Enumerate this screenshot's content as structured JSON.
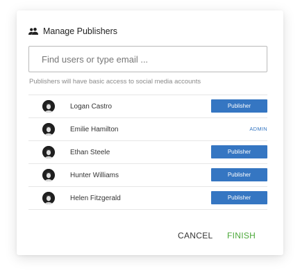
{
  "dialog": {
    "title": "Manage Publishers",
    "title_icon": "people-icon",
    "search": {
      "placeholder": "Find users or type email ...",
      "value": ""
    },
    "hint": "Publishers will have basic access to social media accounts",
    "users": [
      {
        "name": "Logan Castro",
        "role": "Publisher",
        "role_style": "button"
      },
      {
        "name": "Emilie Hamilton",
        "role": "ADMIN",
        "role_style": "link"
      },
      {
        "name": "Ethan Steele",
        "role": "Publisher",
        "role_style": "button"
      },
      {
        "name": "Hunter Williams",
        "role": "Publisher",
        "role_style": "button"
      },
      {
        "name": "Helen Fitzgerald",
        "role": "Publisher",
        "role_style": "button"
      }
    ],
    "actions": {
      "cancel_label": "CANCEL",
      "finish_label": "FINISH"
    }
  },
  "colors": {
    "accent": "#3576c2",
    "finish": "#4aa838"
  }
}
